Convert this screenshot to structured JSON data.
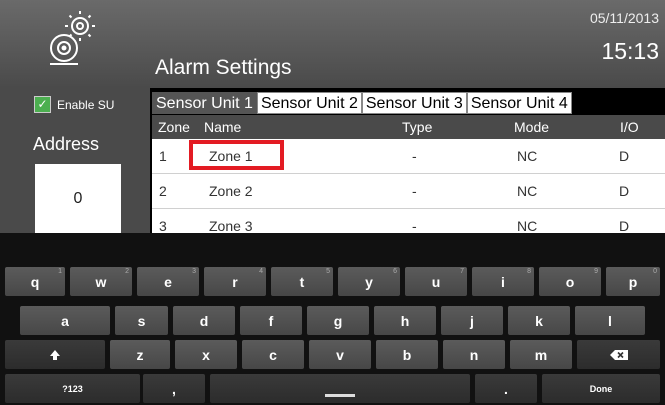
{
  "header": {
    "title": "Alarm Settings",
    "date": "05/11/2013",
    "time": "15:13",
    "logo_icon": "alarm-bell-gear-icon"
  },
  "left_panel": {
    "enable_label": "Enable SU",
    "enable_checked": true,
    "address_label": "Address",
    "address_value": "0"
  },
  "tabs": [
    {
      "label": "Sensor Unit 1",
      "active": true
    },
    {
      "label": "Sensor Unit 2",
      "active": false
    },
    {
      "label": "Sensor Unit 3",
      "active": false
    },
    {
      "label": "Sensor Unit 4",
      "active": false
    }
  ],
  "table": {
    "headers": {
      "zone": "Zone",
      "name": "Name",
      "type": "Type",
      "mode": "Mode",
      "io": "I/O"
    },
    "rows": [
      {
        "zone": "1",
        "name": "Zone 1",
        "type": "-",
        "mode": "NC",
        "io": "D"
      },
      {
        "zone": "2",
        "name": "Zone 2",
        "type": "-",
        "mode": "NC",
        "io": "D"
      },
      {
        "zone": "3",
        "name": "Zone 3",
        "type": "-",
        "mode": "NC",
        "io": "D"
      }
    ]
  },
  "highlight_color": "#e31b23",
  "keyboard": {
    "row1": [
      {
        "label": "q",
        "hint": "1"
      },
      {
        "label": "w",
        "hint": "2"
      },
      {
        "label": "e",
        "hint": "3"
      },
      {
        "label": "r",
        "hint": "4"
      },
      {
        "label": "t",
        "hint": "5"
      },
      {
        "label": "y",
        "hint": "6"
      },
      {
        "label": "u",
        "hint": "7"
      },
      {
        "label": "i",
        "hint": "8"
      },
      {
        "label": "o",
        "hint": "9"
      },
      {
        "label": "p",
        "hint": "0"
      }
    ],
    "row2": [
      "a",
      "s",
      "d",
      "f",
      "g",
      "h",
      "j",
      "k",
      "l"
    ],
    "row3": [
      "z",
      "x",
      "c",
      "v",
      "b",
      "n",
      "m"
    ],
    "shift_icon": "shift-icon",
    "backspace_icon": "backspace-icon",
    "symbols_label": "?123",
    "comma_label": ",",
    "period_label": ".",
    "done_label": "Done"
  }
}
